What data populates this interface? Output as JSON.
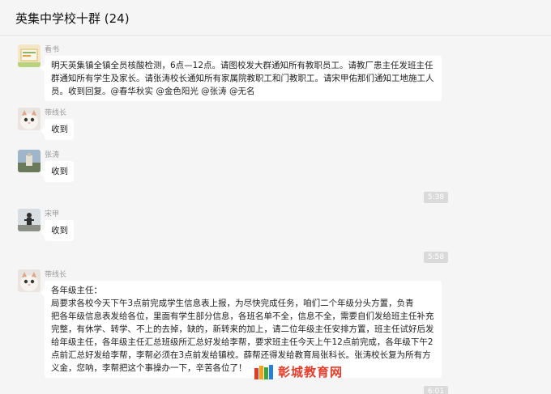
{
  "header": {
    "title": "英集中学校十群 (24)"
  },
  "messages": [
    {
      "sender": "看书",
      "lines": [
        "明天英集镇全镇全员核酸检测，6点—12点。请图校发大群通知所有教职员工。请教厂患主任发班主任",
        "群通知所有学生及家长。请张涛校长通知所有家属院教职工和门教职工。请宋甲佑那们通知工地施工人",
        "员。收到回复。@春华秋实 @金色阳光 @张涛 @无名"
      ]
    },
    {
      "sender": "带线长",
      "lines": [
        "收到"
      ]
    },
    {
      "sender": "张涛",
      "lines": [
        "收到"
      ]
    },
    {
      "sender": "宋甲",
      "lines": [
        "收到"
      ]
    },
    {
      "sender": "带线长",
      "lines": [
        "各年级主任：",
        "        局要求各校今天下午3点前完成学生信息表上报，为尽快完成任务，咱们二个年级分头方置，负青",
        "把各年级信息表发给各位，里面有学生部分信息，各班名单不全，信息不全，需要自们发给班主任补充",
        "完整，有休学、转学、不上的去掉，缺的，新转来的加上，请二位年级主任安排方置，班主任试好后发",
        "给年级主任，各年级主任汇总班级所汇总好发给李帮，要求班主任今天上午12点前完成，各年级下午2",
        "点前汇总好发给李帮，李帮必须在3点前发给镇校。薛帮还得发给教育局张科长。张涛校长复为所有方",
        "义金，您呐，李帮把这个事操办一下，辛苦各位了！"
      ]
    }
  ],
  "times": [
    "5:38",
    "5:58",
    "6:01"
  ],
  "watermark": {
    "text": "彰城教育网"
  }
}
